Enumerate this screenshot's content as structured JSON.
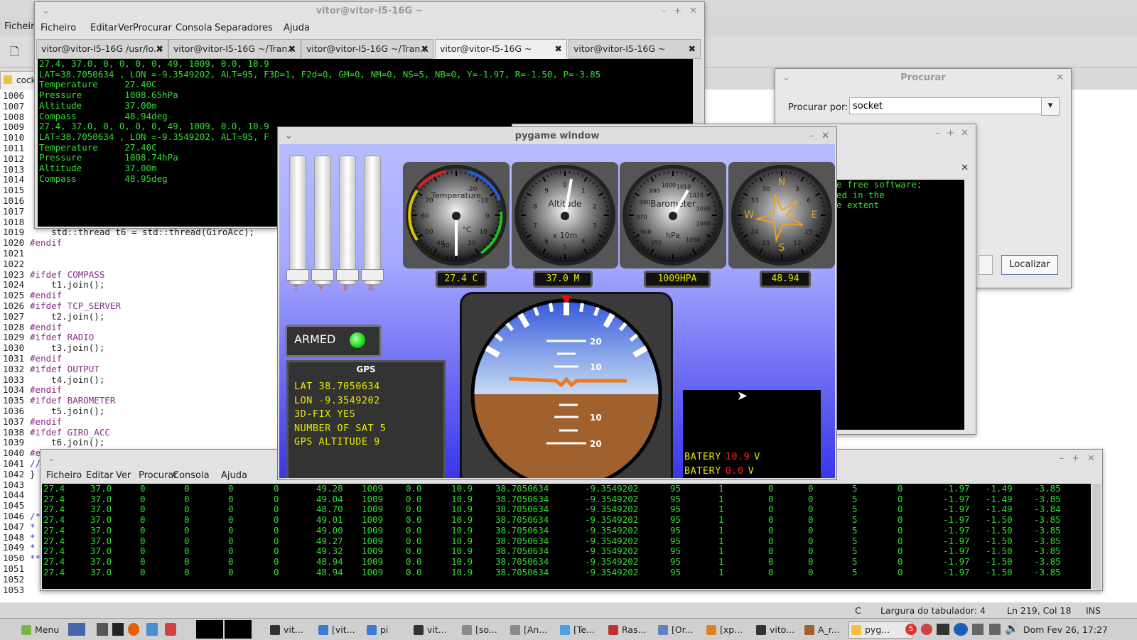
{
  "bg_editor": {
    "menu": [
      "Ficheiro"
    ],
    "tab_label": "cock",
    "lines": [
      {
        "n": "1006",
        "t": ""
      },
      {
        "n": "1007",
        "t": ""
      },
      {
        "n": "1008",
        "t": ""
      },
      {
        "n": "1009",
        "t": ""
      },
      {
        "n": "1010",
        "t": ""
      },
      {
        "n": "1011",
        "t": ""
      },
      {
        "n": "1012",
        "t": ""
      },
      {
        "n": "1013",
        "t": ""
      },
      {
        "n": "1014",
        "t": ""
      },
      {
        "n": "1015",
        "t": ""
      },
      {
        "n": "1016",
        "t": ""
      },
      {
        "n": "1017",
        "t": ""
      },
      {
        "n": "1018",
        "t": ""
      },
      {
        "n": "1019",
        "t": "    std::thread t6 = std::thread(GiroAcc);"
      },
      {
        "n": "1020",
        "t": "#endif"
      },
      {
        "n": "1021",
        "t": ""
      },
      {
        "n": "1022",
        "t": ""
      },
      {
        "n": "1023",
        "t": "#ifdef COMPASS"
      },
      {
        "n": "1024",
        "t": "    t1.join();"
      },
      {
        "n": "1025",
        "t": "#endif"
      },
      {
        "n": "1026",
        "t": "#ifdef TCP_SERVER"
      },
      {
        "n": "1027",
        "t": "    t2.join();"
      },
      {
        "n": "1028",
        "t": "#endif"
      },
      {
        "n": "1029",
        "t": "#ifdef RADIO"
      },
      {
        "n": "1030",
        "t": "    t3.join();"
      },
      {
        "n": "1031",
        "t": "#endif"
      },
      {
        "n": "1032",
        "t": "#ifdef OUTPUT"
      },
      {
        "n": "1033",
        "t": "    t4.join();"
      },
      {
        "n": "1034",
        "t": "#endif"
      },
      {
        "n": "1035",
        "t": "#ifdef BAROMETER"
      },
      {
        "n": "1036",
        "t": "    t5.join();"
      },
      {
        "n": "1037",
        "t": "#endif"
      },
      {
        "n": "1038",
        "t": "#ifdef GIRO_ACC"
      },
      {
        "n": "1039",
        "t": "    t6.join();"
      },
      {
        "n": "1040",
        "t": "#endif"
      },
      {
        "n": "1041",
        "t": "//"
      },
      {
        "n": "1042",
        "t": "}"
      },
      {
        "n": "1043",
        "t": ""
      },
      {
        "n": "1044",
        "t": ""
      },
      {
        "n": "1045",
        "t": ""
      },
      {
        "n": "1046",
        "t": "/*"
      },
      {
        "n": "1047",
        "t": "*   END of main loop"
      },
      {
        "n": "1048",
        "t": "*"
      },
      {
        "n": "1049",
        "t": "*"
      },
      {
        "n": "1050",
        "t": "**"
      },
      {
        "n": "1051",
        "t": ""
      },
      {
        "n": "1052",
        "t": ""
      },
      {
        "n": "1053",
        "t": ""
      }
    ],
    "status": {
      "lang": "C",
      "tab_width": "Largura do tabulador: 4",
      "position": "Ln 219, Col 18",
      "mode": "INS"
    }
  },
  "term_top": {
    "title": "vitor@vitor-I5-16G ~",
    "menu": [
      "Ficheiro",
      "Editar",
      "Ver",
      "Procurar",
      "Consola",
      "Separadores",
      "Ajuda"
    ],
    "tabs": [
      "vitor@vitor-I5-16G /usr/lo...",
      "vitor@vitor-I5-16G ~/Tran...",
      "vitor@vitor-I5-16G ~/Tran...",
      "vitor@vitor-I5-16G ~",
      "vitor@vitor-I5-16G ~"
    ],
    "lines": [
      "27.4, 37.0, 0, 0, 0, 0, 49, 1009, 0.0, 10.9",
      "LAT=38.7050634 , LON =-9.3549202, ALT=95, F3D=1, F2d=0, GM=0, NM=0, NS=5, NB=0, Y=-1.97, R=-1.50, P=-3.85",
      "",
      "Temperature     27.40C",
      "Pressure        1008.65hPa",
      "Altitude        37.00m",
      "Compass         48.94deg",
      "",
      "27.4, 37.0, 0, 0, 0, 0, 49, 1009, 0.0, 10.9",
      "LAT=38.7050634 , LON =-9.3549202, ALT=95, F",
      "",
      "Temperature     27.40C",
      "Pressure        1008.74hPa",
      "Altitude        37.00m",
      "Compass         48.95deg"
    ]
  },
  "term_bottom": {
    "menu": [
      "Ficheiro",
      "Editar",
      "Ver",
      "Procurar",
      "Consola",
      "Ajuda"
    ],
    "rows": [
      [
        "27.4",
        "37.0",
        "0",
        "0",
        "0",
        "0",
        "49.28",
        "1009",
        "0.0",
        "10.9",
        "38.7050634",
        "-9.3549202",
        "95",
        "1",
        "0",
        "0",
        "5",
        "0",
        "-1.97",
        "-1.49",
        "-3.85"
      ],
      [
        "27.4",
        "37.0",
        "0",
        "0",
        "0",
        "0",
        "49.04",
        "1009",
        "0.0",
        "10.9",
        "38.7050634",
        "-9.3549202",
        "95",
        "1",
        "0",
        "0",
        "5",
        "0",
        "-1.97",
        "-1.49",
        "-3.85"
      ],
      [
        "27.4",
        "37.0",
        "0",
        "0",
        "0",
        "0",
        "48.70",
        "1009",
        "0.0",
        "10.9",
        "38.7050634",
        "-9.3549202",
        "95",
        "1",
        "0",
        "0",
        "5",
        "0",
        "-1.97",
        "-1.49",
        "-3.84"
      ],
      [
        "27.4",
        "37.0",
        "0",
        "0",
        "0",
        "0",
        "49.01",
        "1009",
        "0.0",
        "10.9",
        "38.7050634",
        "-9.3549202",
        "95",
        "1",
        "0",
        "0",
        "5",
        "0",
        "-1.97",
        "-1.50",
        "-3.85"
      ],
      [
        "27.4",
        "37.0",
        "0",
        "0",
        "0",
        "0",
        "49.00",
        "1009",
        "0.0",
        "10.9",
        "38.7050634",
        "-9.3549202",
        "95",
        "1",
        "0",
        "0",
        "5",
        "0",
        "-1.97",
        "-1.50",
        "-3.85"
      ],
      [
        "27.4",
        "37.0",
        "0",
        "0",
        "0",
        "0",
        "49.27",
        "1009",
        "0.0",
        "10.9",
        "38.7050634",
        "-9.3549202",
        "95",
        "1",
        "0",
        "0",
        "5",
        "0",
        "-1.97",
        "-1.50",
        "-3.85"
      ],
      [
        "27.4",
        "37.0",
        "0",
        "0",
        "0",
        "0",
        "49.32",
        "1009",
        "0.0",
        "10.9",
        "38.7050634",
        "-9.3549202",
        "95",
        "1",
        "0",
        "0",
        "5",
        "0",
        "-1.97",
        "-1.50",
        "-3.85"
      ],
      [
        "27.4",
        "37.0",
        "0",
        "0",
        "0",
        "0",
        "48.94",
        "1009",
        "0.0",
        "10.9",
        "38.7050634",
        "-9.3549202",
        "95",
        "1",
        "0",
        "0",
        "5",
        "0",
        "-1.97",
        "-1.50",
        "-3.85"
      ],
      [
        "27.4",
        "37.0",
        "0",
        "0",
        "0",
        "0",
        "48.94",
        "1009",
        "0.0",
        "10.9",
        "38.7050634",
        "-9.3549202",
        "95",
        "1",
        "0",
        "0",
        "5",
        "0",
        "-1.97",
        "-1.50",
        "-3.85"
      ]
    ]
  },
  "search_dialog": {
    "title": "Procurar",
    "label": "Procurar por:",
    "value": "socket",
    "button": "Localizar"
  },
  "license_text": [
    "e free software;",
    "ed in the",
    "",
    "",
    "e extent"
  ],
  "pygame": {
    "title": "pygame window",
    "sliders": {
      "labels": [
        "T",
        "Y",
        "P",
        "R"
      ],
      "levels": [
        0.0,
        0.0,
        0.0,
        0.0
      ]
    },
    "armed_label": "ARMED",
    "gauges": [
      {
        "name": "Temperature",
        "unit": "°C",
        "ticks": [
          "70",
          "60",
          "50",
          "40",
          "30",
          "20",
          "10",
          "0",
          "-10",
          "-20"
        ],
        "top_ticks": [
          "80",
          "-20"
        ]
      },
      {
        "name": "Altitude",
        "unit": "x 10m",
        "ticks": [
          "0",
          "1",
          "2",
          "3",
          "4",
          "5",
          "6",
          "7",
          "8",
          "9"
        ]
      },
      {
        "name": "Barometer",
        "unit": "hPa",
        "ticks": [
          "950",
          "960",
          "970",
          "980",
          "990",
          "1000",
          "1010",
          "1020",
          "1030",
          "1040",
          "1050"
        ]
      },
      {
        "name": "Compass",
        "ticks": [
          "N",
          "E",
          "S",
          "W",
          "3",
          "6",
          "12",
          "15",
          "21",
          "24",
          "30",
          "33"
        ]
      }
    ],
    "readouts": [
      "27.4 C",
      "37.0 M",
      "1009HPA",
      "48.94"
    ],
    "horizon_ticks": [
      "20",
      "10",
      "10",
      "20"
    ],
    "gps": {
      "title": "GPS",
      "lines": [
        "LAT 38.7050634",
        "LON -9.3549202",
        "3D-FIX YES",
        "NUMBER OF SAT 5",
        "GPS ALTITUDE 9"
      ]
    },
    "battery": [
      {
        "label": "BATERY",
        "value": "10.9",
        "unit": "V"
      },
      {
        "label": "BATERY",
        "value": "0.0",
        "unit": "V"
      }
    ],
    "colors": {
      "led_yellow": "#e8e800",
      "battery_value": "#ff2222",
      "armed_led": "#22dd22",
      "sky": "#b6cdf0",
      "ground": "#a0612e",
      "wings": "#f07820"
    }
  },
  "taskbar": {
    "menu_label": "Menu",
    "items": [
      "vit...",
      "[vit...",
      "pi",
      "vit...",
      "[so...",
      "[An...",
      "[Te...",
      "Ras...",
      "[Or...",
      "[xp...",
      "vito...",
      "A_r...",
      "pyg..."
    ],
    "clock": "Dom Fev 26, 17:27"
  }
}
